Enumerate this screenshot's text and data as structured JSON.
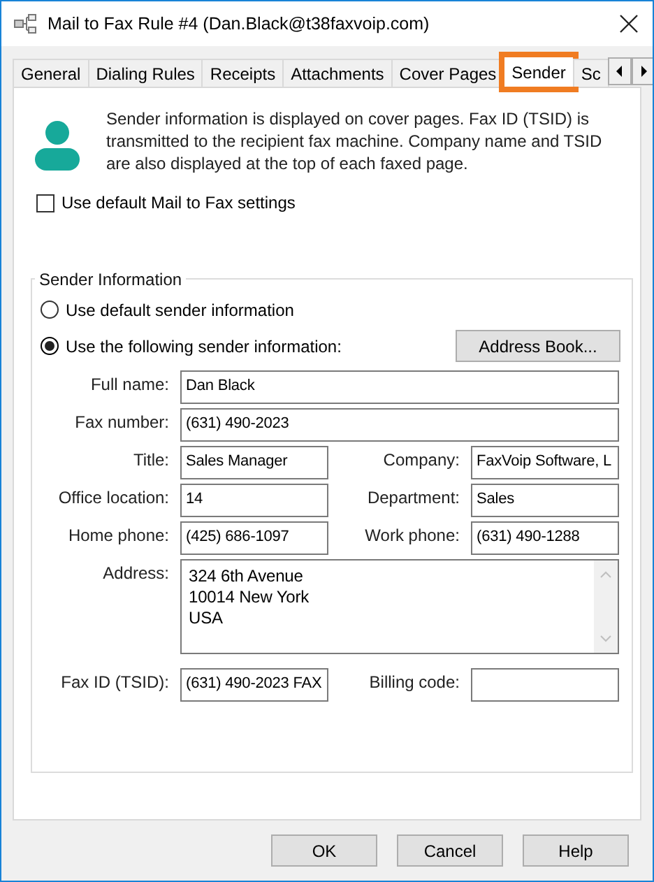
{
  "window": {
    "title": "Mail to Fax Rule #4 (Dan.Black@t38faxvoip.com)"
  },
  "tabs": [
    {
      "label": "General",
      "selected": false,
      "highlighted": false
    },
    {
      "label": "Dialing Rules",
      "selected": false,
      "highlighted": false
    },
    {
      "label": "Receipts",
      "selected": false,
      "highlighted": false
    },
    {
      "label": "Attachments",
      "selected": false,
      "highlighted": false
    },
    {
      "label": "Cover Pages",
      "selected": false,
      "highlighted": false
    },
    {
      "label": "Sender",
      "selected": true,
      "highlighted": true
    },
    {
      "label": "Sc",
      "selected": false,
      "highlighted": false
    }
  ],
  "info": "Sender information is displayed on cover pages. Fax ID (TSID) is transmitted to the recipient fax machine. Company name and TSID are also displayed at the top of each faxed page.",
  "default_settings": {
    "label": "Use default Mail to Fax settings",
    "checked": false
  },
  "sender_group": {
    "title": "Sender Information",
    "options": [
      {
        "label": "Use default sender information",
        "selected": false
      },
      {
        "label": "Use the following sender information:",
        "selected": true
      }
    ],
    "address_book_button": "Address Book...",
    "fields": [
      {
        "label": "Full name:",
        "value": "Dan Black",
        "kind": "full"
      },
      {
        "label": "Fax number:",
        "value": "(631) 490-2023",
        "kind": "full"
      },
      {
        "label": "Title:",
        "value": "Sales Manager",
        "kind": "half"
      },
      {
        "label": "Company:",
        "value": "FaxVoip Software, L",
        "kind": "half"
      },
      {
        "label": "Office location:",
        "value": "14",
        "kind": "half"
      },
      {
        "label": "Department:",
        "value": "Sales",
        "kind": "half"
      },
      {
        "label": "Home phone:",
        "value": "(425) 686-1097",
        "kind": "half"
      },
      {
        "label": "Work phone:",
        "value": "(631) 490-1288",
        "kind": "half"
      },
      {
        "label": "Address:",
        "lines": [
          "324 6th Avenue",
          "10014 New York",
          "USA"
        ],
        "kind": "multiline"
      },
      {
        "label": "Fax ID (TSID):",
        "value": "(631) 490-2023 FAX",
        "kind": "half"
      },
      {
        "label": "Billing code:",
        "kind": "half"
      }
    ]
  },
  "buttons": [
    "OK",
    "Cancel",
    "Help"
  ]
}
